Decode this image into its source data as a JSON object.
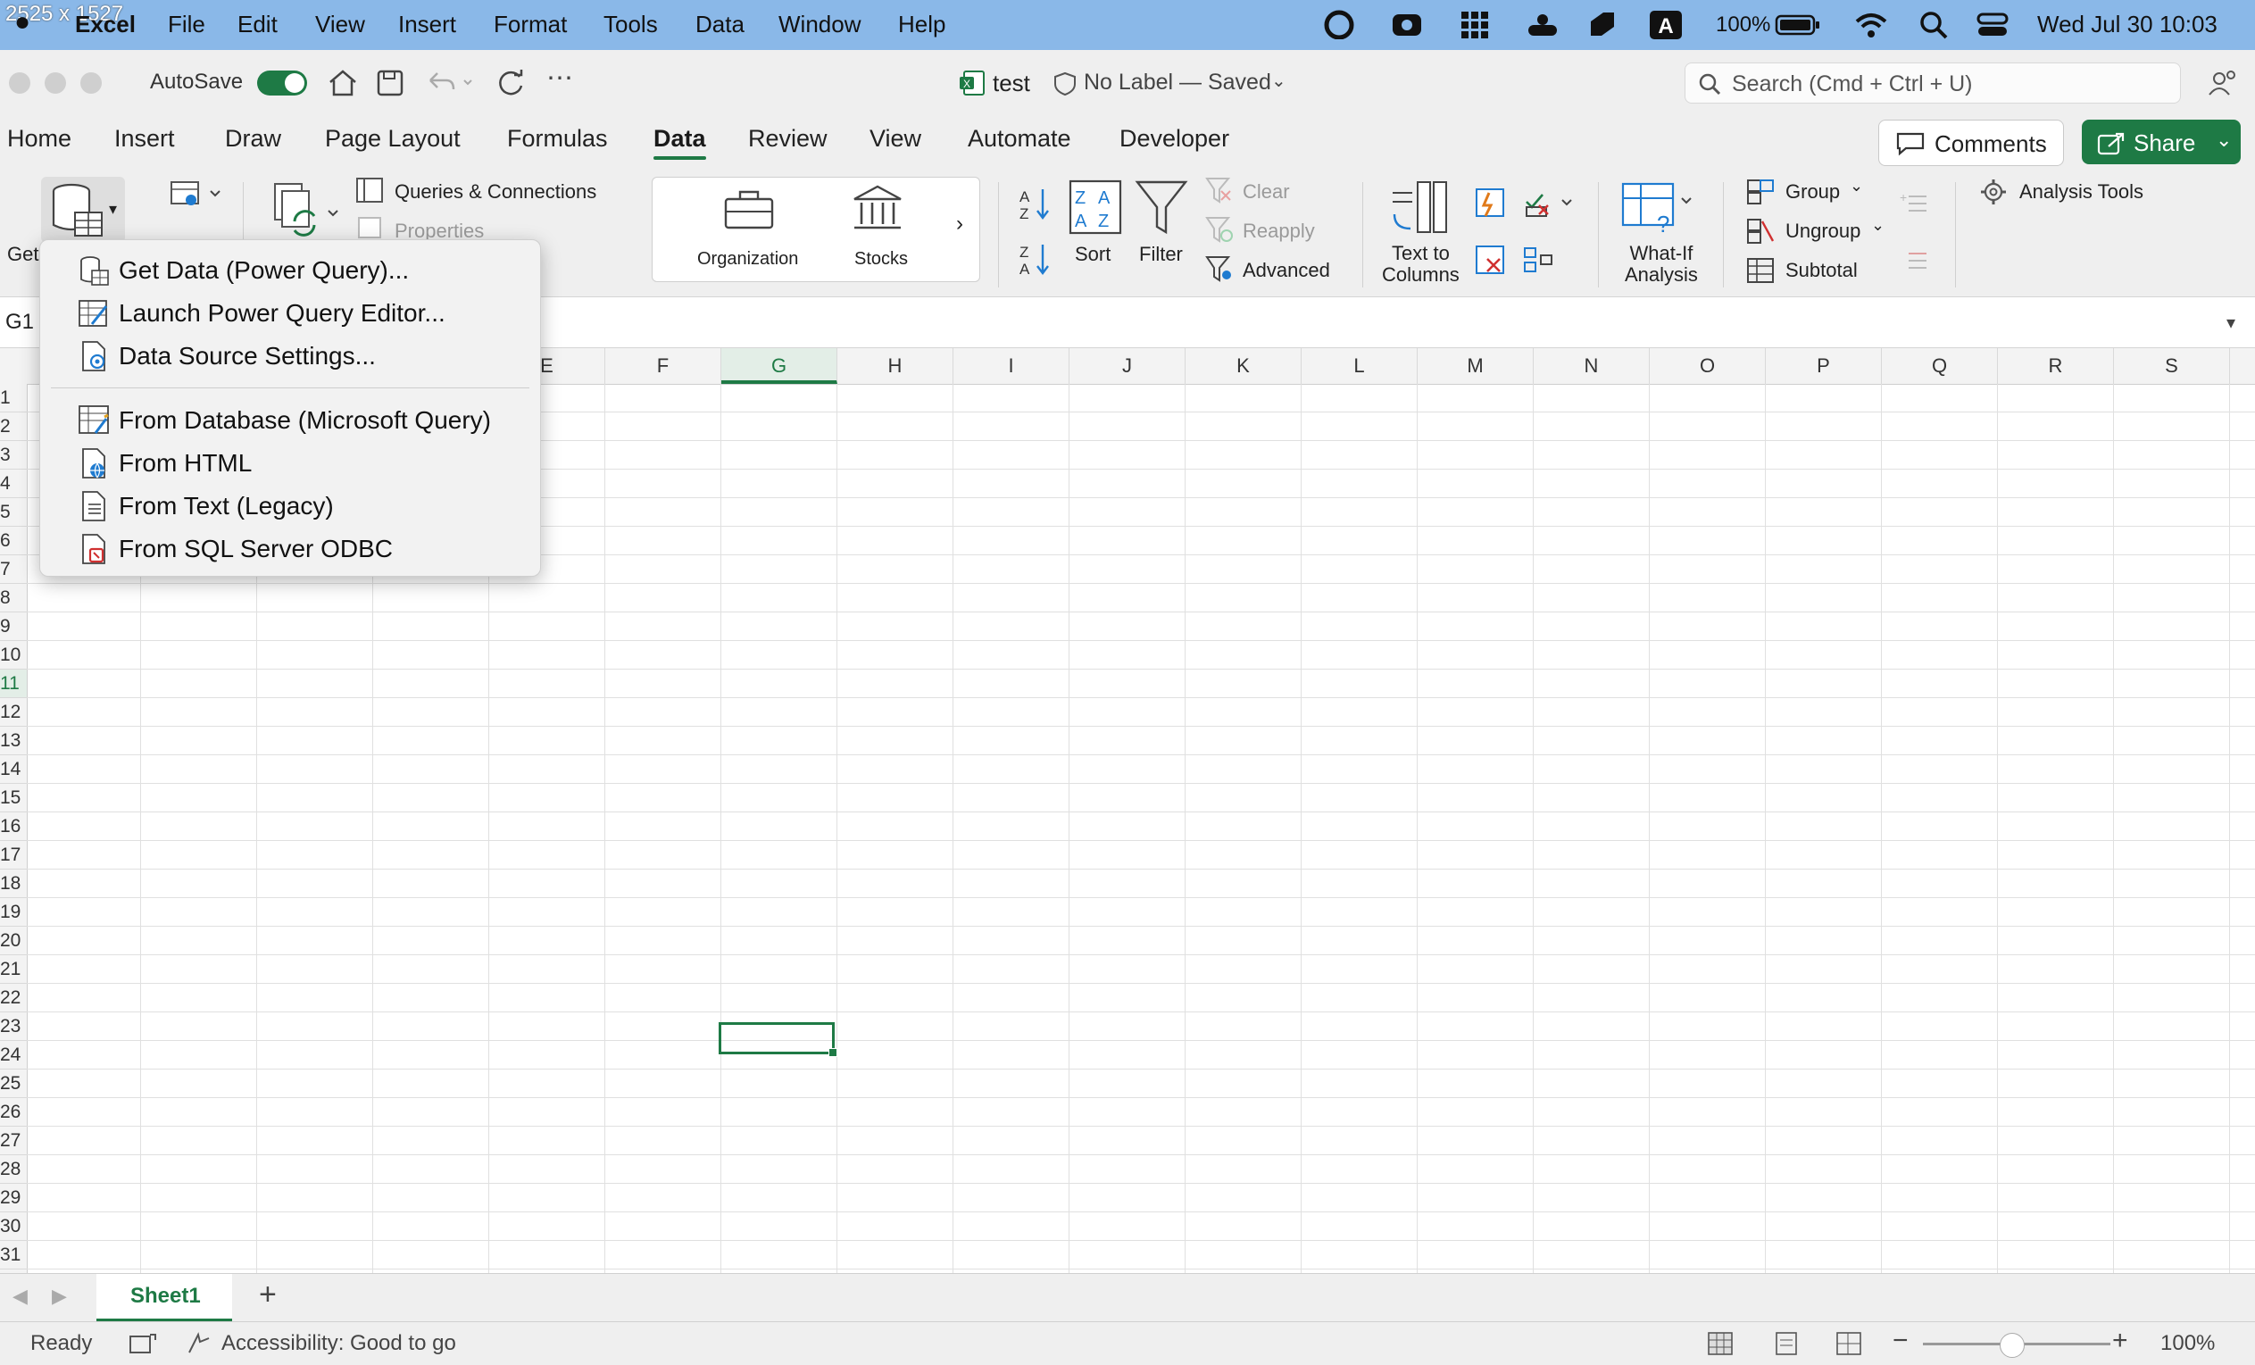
{
  "screen_dims_overlay": "2525 x 1527",
  "mac_menu": {
    "app": "Excel",
    "items": [
      "File",
      "Edit",
      "View",
      "Insert",
      "Format",
      "Tools",
      "Data",
      "Window",
      "Help"
    ],
    "battery": "100%",
    "clock": "Wed Jul 30  10:03"
  },
  "titlebar": {
    "autosave_label": "AutoSave",
    "doc_name": "test",
    "doc_label": "No Label — Saved",
    "search_placeholder": "Search (Cmd + Ctrl + U)"
  },
  "ribbon_tabs": [
    "Home",
    "Insert",
    "Draw",
    "Page Layout",
    "Formulas",
    "Data",
    "Review",
    "View",
    "Automate",
    "Developer"
  ],
  "active_tab": "Data",
  "buttons": {
    "comments": "Comments",
    "share": "Share"
  },
  "ribbon": {
    "get_data_partial": "Get",
    "queries_connections": "Queries & Connections",
    "properties": "Properties",
    "organization": "Organization",
    "stocks": "Stocks",
    "sort": "Sort",
    "filter": "Filter",
    "clear": "Clear",
    "reapply": "Reapply",
    "advanced": "Advanced",
    "text_to_columns_1": "Text to",
    "text_to_columns_2": "Columns",
    "what_if_1": "What-If",
    "what_if_2": "Analysis",
    "group": "Group",
    "ungroup": "Ungroup",
    "subtotal": "Subtotal",
    "analysis_tools": "Analysis Tools"
  },
  "formula_bar": {
    "name_box_partial": "G1"
  },
  "dropdown": {
    "items": [
      "Get Data (Power Query)...",
      "Launch Power Query Editor...",
      "Data Source Settings...",
      "From Database (Microsoft Query)",
      "From HTML",
      "From Text (Legacy)",
      "From SQL Server ODBC"
    ]
  },
  "grid": {
    "columns": [
      "E",
      "F",
      "G",
      "H",
      "I",
      "J",
      "K",
      "L",
      "M",
      "N",
      "O",
      "P",
      "Q",
      "R",
      "S"
    ],
    "rows": [
      "1",
      "2",
      "3",
      "4",
      "5",
      "6",
      "7",
      "8",
      "9",
      "10",
      "11",
      "12",
      "13",
      "14",
      "15",
      "16",
      "17",
      "18",
      "19",
      "20",
      "21",
      "22",
      "23",
      "24",
      "25",
      "26",
      "27",
      "28",
      "29",
      "30",
      "31"
    ],
    "selected_column": "G",
    "selected_row": "11"
  },
  "sheet_tab": "Sheet1",
  "status": {
    "ready": "Ready",
    "accessibility": "Accessibility: Good to go",
    "zoom": "100%"
  },
  "colors": {
    "accent": "#1e7a45",
    "menubar": "#8ab8e8"
  }
}
